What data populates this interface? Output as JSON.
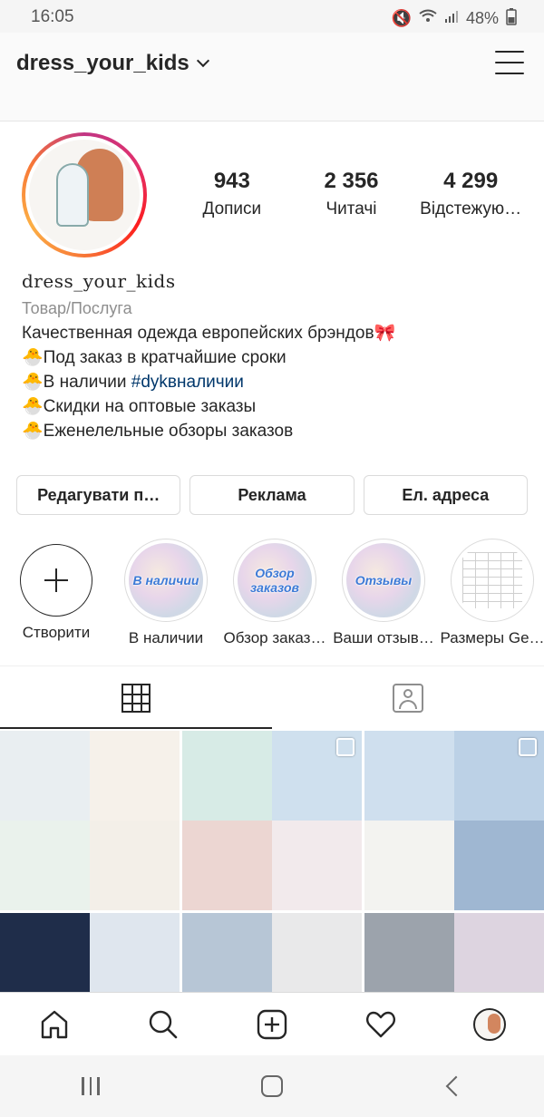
{
  "status_bar": {
    "time": "16:05",
    "battery": "48%"
  },
  "header": {
    "username": "dress_your_kids"
  },
  "profile": {
    "stats": [
      {
        "value": "943",
        "label": "Дописи"
      },
      {
        "value": "2 356",
        "label": "Читачі"
      },
      {
        "value": "4 299",
        "label": "Відстежую…"
      }
    ],
    "display_name": "dress_your_kids",
    "category": "Товар/Послуга",
    "bio": {
      "line1": "Качественная одежда европейских брэндов🎀",
      "line2": "🐣Под заказ в кратчайшие сроки",
      "line3_prefix": "🐣В наличии ",
      "line3_tag": "#dykвналичии",
      "line4": "🐣Скидки на оптовые заказы",
      "line5": "🐣Еженелельные обзоры заказов"
    }
  },
  "buttons": {
    "edit": "Редагувати п…",
    "promote": "Реклама",
    "email": "Ел. адреса"
  },
  "highlights": [
    {
      "label": "Створити",
      "text": ""
    },
    {
      "label": "В наличии",
      "text": "В наличии"
    },
    {
      "label": "Обзор заказ…",
      "text": "Обзор заказов"
    },
    {
      "label": "Ваши отзыв…",
      "text": "Отзывы"
    },
    {
      "label": "Размеры Ge…",
      "text": ""
    }
  ],
  "tabs": {
    "grid": "grid-icon",
    "tagged": "tagged-icon"
  },
  "posts": [
    {
      "colors": [
        "#e9eef1",
        "#f6f1ea",
        "#eaf2ec",
        "#f3efe8"
      ],
      "multi": false
    },
    {
      "colors": [
        "#d7ebe6",
        "#cfe0ee",
        "#ecd6d2",
        "#f2eaec"
      ],
      "multi": true
    },
    {
      "colors": [
        "#cfdfee",
        "#bcd1e6",
        "#f3f3f0",
        "#9fb7d2"
      ],
      "multi": true
    },
    {
      "colors": [
        "#1f2d4a",
        "#dfe6ee",
        "#aac8e4",
        "#f0f0f0"
      ],
      "multi": false
    },
    {
      "colors": [
        "#b7c6d6",
        "#e9e9ea",
        "#c8d6e6",
        "#efefef"
      ],
      "multi": false
    },
    {
      "colors": [
        "#9ca3ac",
        "#ddd4e0",
        "#4a4f58",
        "#e6e6e6"
      ],
      "multi": false
    }
  ],
  "bottom_nav": [
    "home-icon",
    "search-icon",
    "new-post-icon",
    "activity-heart-icon",
    "profile-avatar"
  ],
  "colors": {
    "accent": "#00376b",
    "text": "#262626",
    "muted": "#8e8e8e",
    "border": "#dbdbdb"
  }
}
